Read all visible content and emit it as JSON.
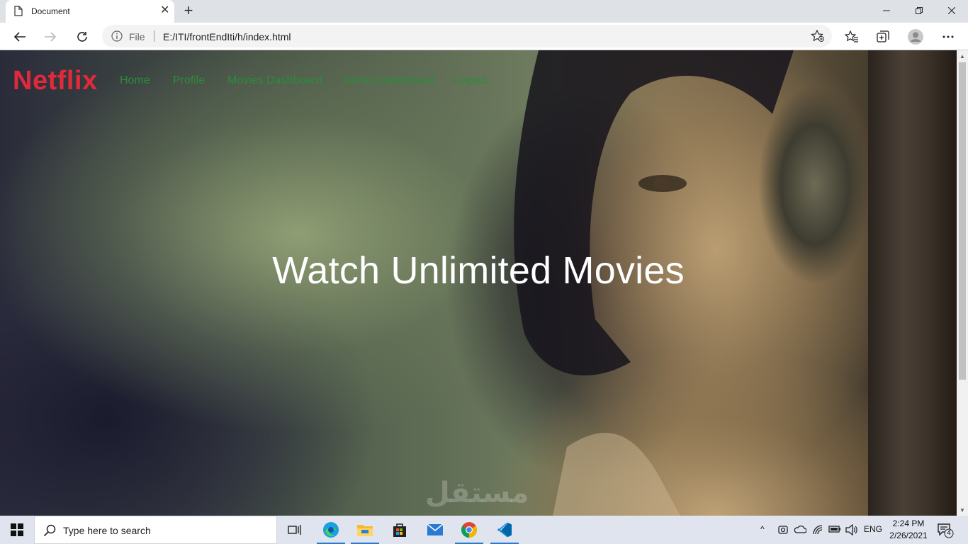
{
  "browser": {
    "tab_title": "Document",
    "address_scheme": "File",
    "address_url": "E:/ITI/frontEndIti/h/index.html"
  },
  "site": {
    "brand": "Netflix",
    "nav": [
      {
        "label": "Home"
      },
      {
        "label": "Profile"
      },
      {
        "label": "Movies Dashboard"
      },
      {
        "label": "Series Dashboard"
      },
      {
        "label": "Logout"
      }
    ],
    "hero_text": "Watch Unlimited Movies",
    "watermark": "مستقل",
    "colors": {
      "brand": "#e02a3b",
      "nav_link": "#2f8a3a",
      "hero_text": "#ffffff"
    }
  },
  "taskbar": {
    "search_placeholder": "Type here to search",
    "language": "ENG",
    "time": "2:24 PM",
    "date": "2/26/2021",
    "notification_count": "4",
    "apps": [
      "task-view",
      "edge",
      "file-explorer",
      "store",
      "mail",
      "chrome",
      "vscode"
    ]
  }
}
